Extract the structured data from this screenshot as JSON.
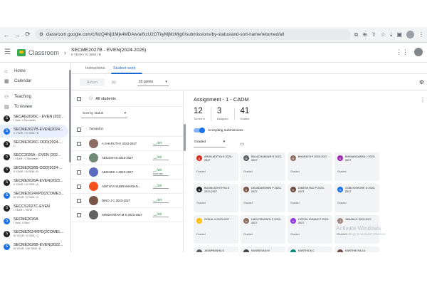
{
  "browser": {
    "url": "classroom.google.com/c/NzQ4Njl1Mjk4MDAw/a/NzU2OTkyMjMzMjg0/submissions/by-status/and-sort-name/returned/all"
  },
  "app": {
    "name": "Classroom",
    "class_title": "SECME2027B - EVEN(2024-2025)",
    "class_sub": "II YEAR / IV SEM / B"
  },
  "nav": {
    "home": "Home",
    "calendar": "Calendar",
    "teaching": "Teaching",
    "to_review": "To review"
  },
  "classes": [
    {
      "letter": "S",
      "name": "SECAG2026C - EVEN (202...",
      "sub": "I Year, II Semester",
      "color": "#202124",
      "active": false
    },
    {
      "letter": "S",
      "name": "SECME2027B-EVEN(2024...",
      "sub": "II YEAR / IV SEM / B",
      "color": "#1a73e8",
      "active": true
    },
    {
      "letter": "S",
      "name": "SECME2026C-ODD(2024-...",
      "sub": "C",
      "color": "#202124",
      "active": false
    },
    {
      "letter": "S",
      "name": "SECC2026A - EVEN (202...",
      "sub": "I YEAR / II Semester",
      "color": "#202124",
      "active": false
    },
    {
      "letter": "S",
      "name": "SECME2026B-ODD(2024-...",
      "sub": "II YEAR / III SEM / B",
      "color": "#202124",
      "active": false
    },
    {
      "letter": "S",
      "name": "SECME2026A-EVEN(2023...",
      "sub": "II YEAR / IV SEM / A",
      "color": "#202124",
      "active": false
    },
    {
      "letter": "S",
      "name": "SECME2024XPD(2COME3...",
      "sub": "III YEAR / V SEM / A",
      "color": "#1a73e8",
      "active": false
    },
    {
      "letter": "S",
      "name": "SECCS2027C-EVEN",
      "sub": "I YEAR / I SEM",
      "color": "#202124",
      "active": false
    },
    {
      "letter": "S",
      "name": "SECME2026A",
      "sub": "I Year, II Sem",
      "color": "#1a73e8",
      "active": false
    },
    {
      "letter": "S",
      "name": "SECME2024XPD(2COMEL...",
      "sub": "III YEAR / V SEM / C",
      "color": "#202124",
      "active": false
    },
    {
      "letter": "S",
      "name": "SECME2026B-EVEN(2022...",
      "sub": "III YEAR / VIII SEM / B",
      "color": "#1a73e8",
      "active": false
    },
    {
      "letter": "S",
      "name": "SECME2026 - PROJECT",
      "sub": "",
      "color": "#202124",
      "active": false
    }
  ],
  "tabs": {
    "instructions": "Instructions",
    "student_work": "Student work"
  },
  "toolbar": {
    "return_label": "Return",
    "points_label": "20 points"
  },
  "list": {
    "all_students": "All students",
    "sort_label": "Sort by status",
    "turned_in": "Turned in",
    "students": [
      {
        "name": "A SHARUTHY 2023-2027",
        "grade": "__/20",
        "sub": "",
        "photo": "#8d6e63"
      },
      {
        "name": "ABILESH B 2023-2027",
        "grade": "__/20",
        "sub": "",
        "photo": "#6d8b74"
      },
      {
        "name": "ABISHEK A 2023-2027",
        "grade": "__/20",
        "sub": "Done late",
        "photo": "#5c6bc0"
      },
      {
        "name": "ADITHYA SUBRAMANIAN...",
        "grade": "__/20",
        "sub": "",
        "photo": "#f4511e"
      },
      {
        "name": "DINO J C 2023-2027",
        "grade": "__/20",
        "sub": "",
        "photo": "#795548"
      },
      {
        "name": "SIRIDHARAN M S 2023-2027",
        "grade": "__/20",
        "sub": "",
        "photo": "#616161"
      }
    ]
  },
  "assignment": {
    "title": "Assignment - 1 - CADM",
    "turned_in_count": "12",
    "turned_in_label": "Turned in",
    "assigned_count": "3",
    "assigned_label": "Assigned",
    "graded_count": "41",
    "graded_label": "Graded",
    "accepting": "Accepting submissions",
    "filter": "Graded"
  },
  "cards": [
    {
      "name": "ARUN ADITYA S 2023-2027",
      "status": "Graded",
      "color": "#d93025",
      "letter": "A"
    },
    {
      "name": "BALACHANDAR R 2023-2027",
      "status": "Graded",
      "color": "#5f6368",
      "letter": "B"
    },
    {
      "name": "BHARATH P 2023-2027",
      "status": "Graded",
      "color": "#8d6e63",
      "letter": "B"
    },
    {
      "name": "BHAVANGARAN J 2023-2027",
      "status": "Graded",
      "color": "#9c27b0",
      "letter": "B"
    },
    {
      "name": "BUVAN ATHITHYA S 2023-2027",
      "status": "Graded",
      "color": "#202124",
      "letter": "B"
    },
    {
      "name": "DEVADARSHINI P 2023-2027",
      "status": "Graded",
      "color": "#795548",
      "letter": "D"
    },
    {
      "name": "DINESH RAJ P 2023-2027",
      "status": "Graded",
      "color": "#6d4c41",
      "letter": "D"
    },
    {
      "name": "GOBI KISHORE D 2023-2027",
      "status": "Graded",
      "color": "#1a73e8",
      "letter": "G"
    },
    {
      "name": "GOKUL A 2023-2027",
      "status": "Graded",
      "color": "#fbbc04",
      "letter": "G"
    },
    {
      "name": "HARI PRASATH P 2023-2027",
      "status": "Graded",
      "color": "#8d6e63",
      "letter": "H"
    },
    {
      "name": "HITESH KUMAR P 2023-2027",
      "status": "Graded",
      "color": "#9334e6",
      "letter": "H"
    },
    {
      "name": "JANANI G 2023-2027",
      "status": "Graded",
      "color": "#a1887f",
      "letter": "J"
    },
    {
      "name": "JAYAPRASHA S",
      "status": "",
      "color": "#5f6368",
      "letter": "J"
    },
    {
      "name": "KANISEVAN M",
      "status": "",
      "color": "#424242",
      "letter": "K"
    },
    {
      "name": "KARTHICK C",
      "status": "",
      "color": "#00897b",
      "letter": "K"
    },
    {
      "name": "KARTHIK RAJ A",
      "status": "",
      "color": "#6d4c41",
      "letter": "K"
    }
  ],
  "watermark": {
    "line1": "Activate Windows",
    "line2": "Go to Settings to activate Windows."
  }
}
